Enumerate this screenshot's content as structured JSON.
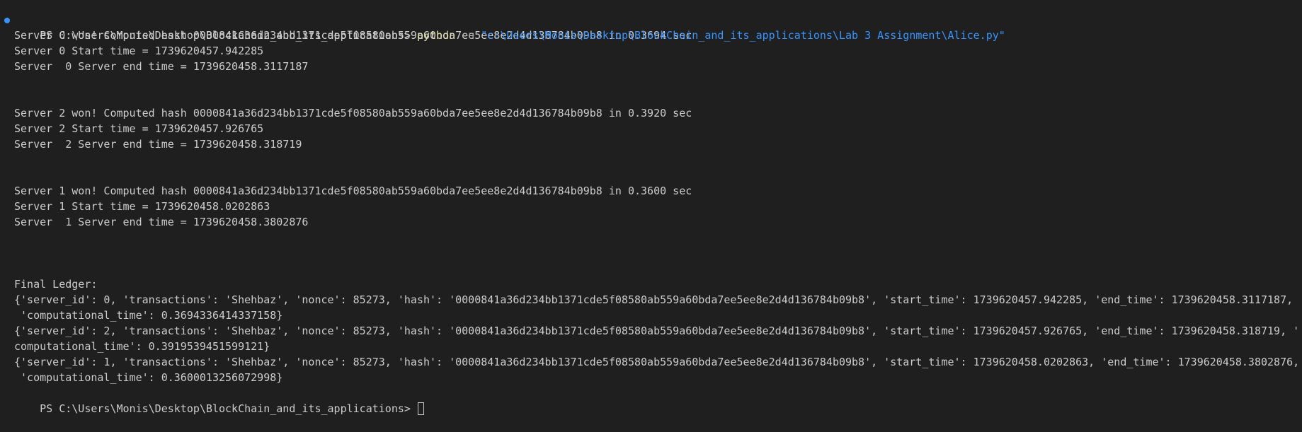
{
  "terminal": {
    "prompt": "PS C:\\Users\\Monis\\Desktop\\BlockChain_and_its_applications>",
    "command": {
      "executable": "python",
      "flag": "-u",
      "path": "\"c:\\Users\\Monis\\Desktop\\BlockChain_and_its_applications\\Lab 3 Assignment\\Alice.py\""
    },
    "blocks": [
      {
        "won": "Server 0 won! Computed hash 0000841a36d234bb1371cde5f08580ab559a60bda7ee5ee8e2d4d136784b09b8 in 0.3694 sec",
        "start": "Server 0 Start time = 1739620457.942285",
        "end": "Server  0 Server end time = 1739620458.3117187"
      },
      {
        "won": "Server 2 won! Computed hash 0000841a36d234bb1371cde5f08580ab559a60bda7ee5ee8e2d4d136784b09b8 in 0.3920 sec",
        "start": "Server 2 Start time = 1739620457.926765",
        "end": "Server  2 Server end time = 1739620458.318719"
      },
      {
        "won": "Server 1 won! Computed hash 0000841a36d234bb1371cde5f08580ab559a60bda7ee5ee8e2d4d136784b09b8 in 0.3600 sec",
        "start": "Server 1 Start time = 1739620458.0202863",
        "end": "Server  1 Server end time = 1739620458.3802876"
      }
    ],
    "ledger_title": "Final Ledger:",
    "ledger_lines": [
      "{'server_id': 0, 'transactions': 'Shehbaz', 'nonce': 85273, 'hash': '0000841a36d234bb1371cde5f08580ab559a60bda7ee5ee8e2d4d136784b09b8', 'start_time': 1739620457.942285, 'end_time': 1739620458.3117187,",
      " 'computational_time': 0.3694336414337158}",
      "{'server_id': 2, 'transactions': 'Shehbaz', 'nonce': 85273, 'hash': '0000841a36d234bb1371cde5f08580ab559a60bda7ee5ee8e2d4d136784b09b8', 'start_time': 1739620457.926765, 'end_time': 1739620458.318719, '",
      "computational_time': 0.3919539451599121}",
      "{'server_id': 1, 'transactions': 'Shehbaz', 'nonce': 85273, 'hash': '0000841a36d234bb1371cde5f08580ab559a60bda7ee5ee8e2d4d136784b09b8', 'start_time': 1739620458.0202863, 'end_time': 1739620458.3802876,",
      " 'computational_time': 0.3600013256072998}"
    ],
    "final_prompt": "PS C:\\Users\\Monis\\Desktop\\BlockChain_and_its_applications>"
  },
  "colors": {
    "background": "#1f1f1f",
    "text": "#cccccc",
    "executable": "#dcdcaa",
    "flag": "#9d9d9d",
    "path": "#3794ff",
    "status_dot": "#3794ff"
  },
  "icons": {
    "status": "command-status-dot-icon",
    "cursor": "block-cursor-icon"
  }
}
